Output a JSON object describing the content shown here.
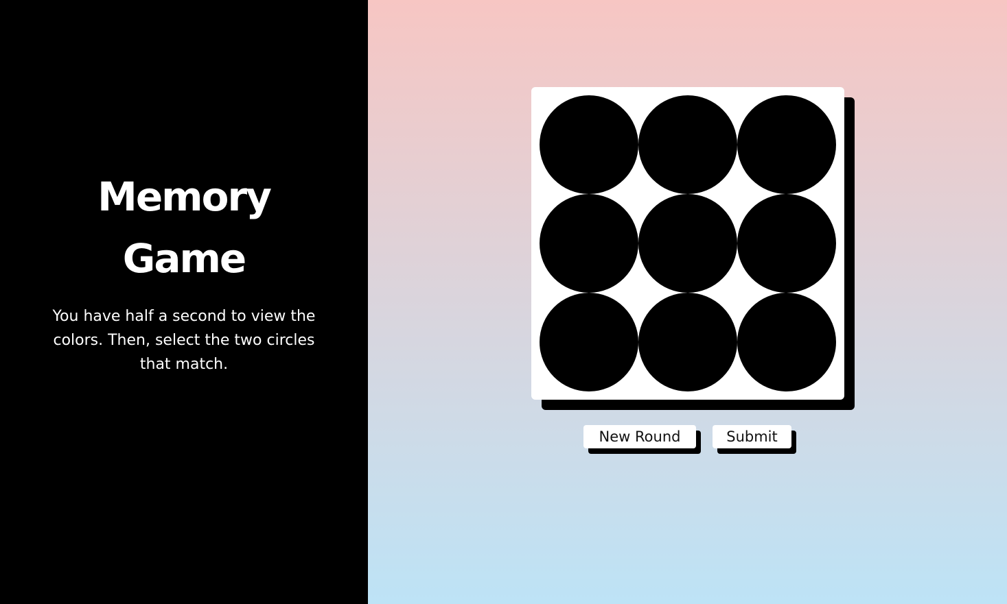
{
  "sidebar": {
    "title": "Memory Game",
    "instructions": "You have half a second to view the colors. Then, select the two circles that match."
  },
  "board": {
    "rows": 3,
    "columns": 3,
    "circle_color": "#000000",
    "board_color": "#ffffff"
  },
  "controls": {
    "new_round_label": "New Round",
    "submit_label": "Submit"
  },
  "theme": {
    "sidebar_bg": "#000000",
    "gradient_top": "#f7c6c3",
    "gradient_bottom": "#bde3f6"
  }
}
